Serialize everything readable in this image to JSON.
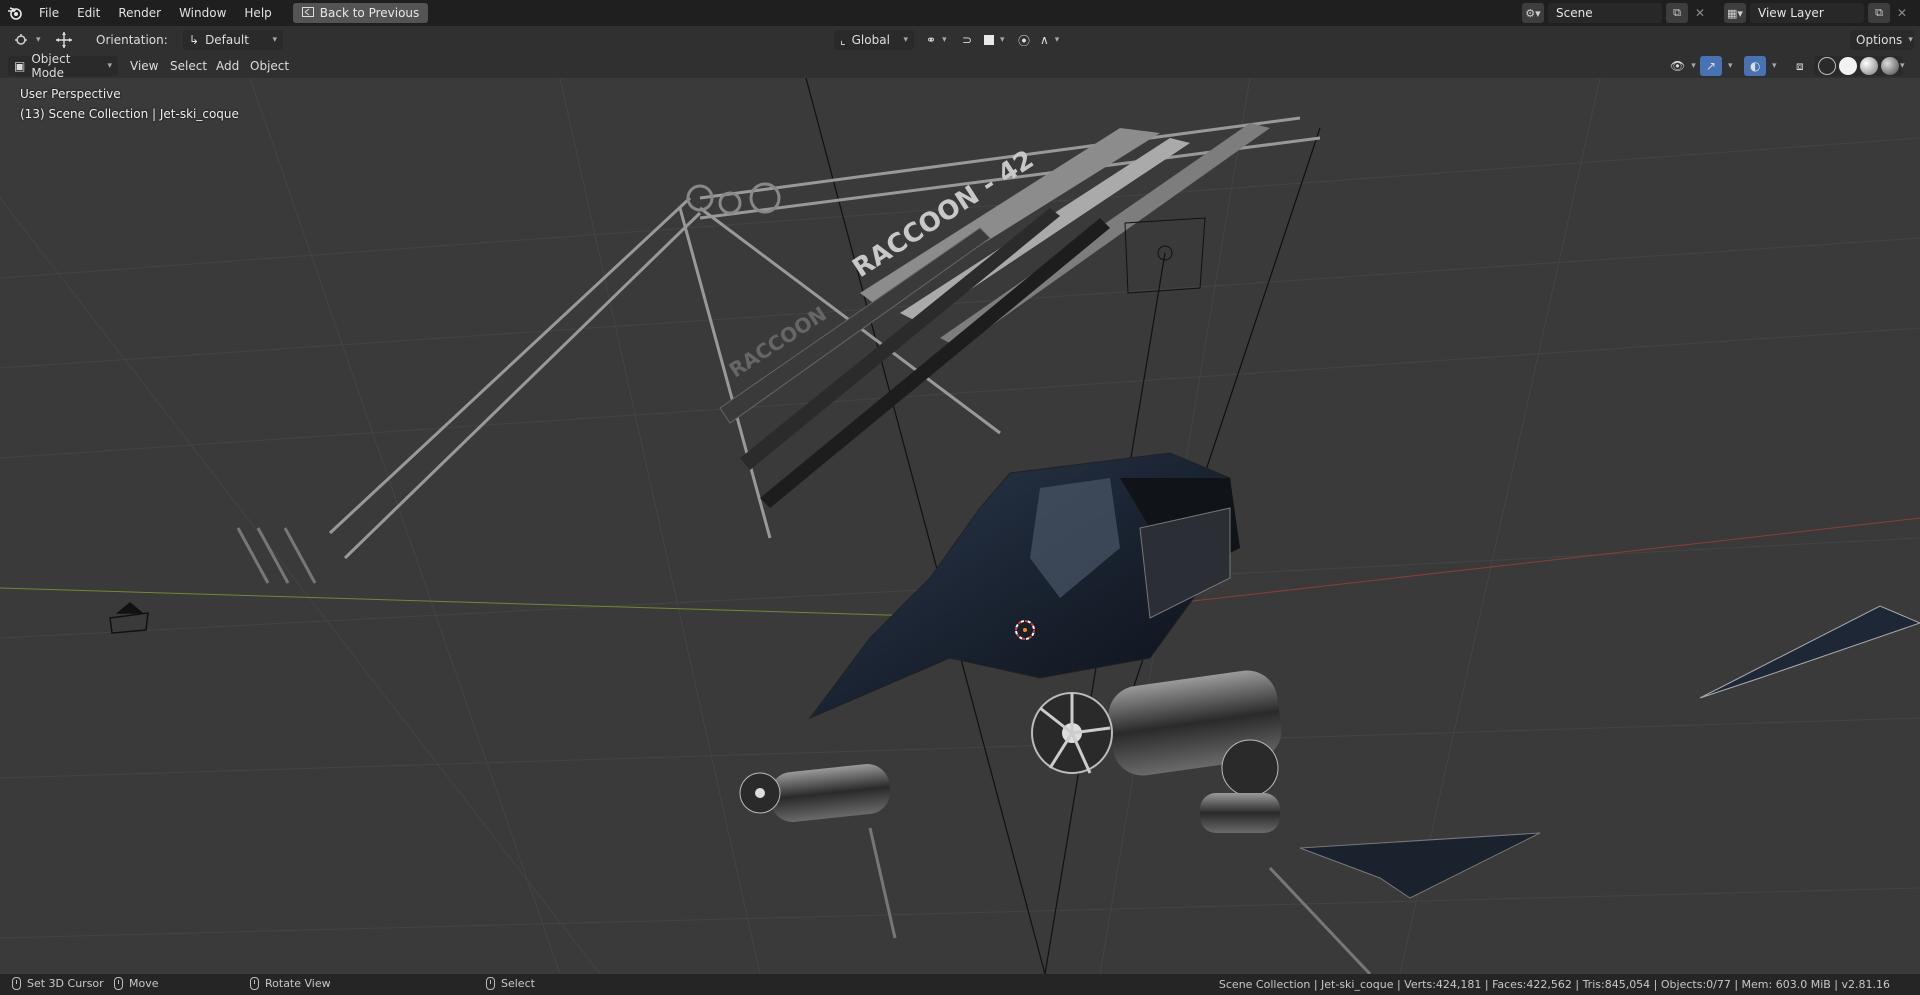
{
  "menu": [
    "File",
    "Edit",
    "Render",
    "Window",
    "Help"
  ],
  "back_button": "Back to Previous",
  "scene": {
    "label": "Scene"
  },
  "view_layer": {
    "label": "View Layer"
  },
  "toolbar": {
    "orientation_label": "Orientation:",
    "orientation_value": "Default",
    "transform_space": "Global",
    "options": "Options"
  },
  "viewport_header": {
    "mode": "Object Mode",
    "menus": [
      "View",
      "Select",
      "Add",
      "Object"
    ]
  },
  "overlay": {
    "perspective": "User Perspective",
    "collection": "(13) Scene Collection | Jet-ski_coque"
  },
  "model_labels": [
    "RACCOON - 42",
    "RACCOON"
  ],
  "status": {
    "hints": [
      "Set 3D Cursor",
      "Move",
      "Rotate View",
      "Select"
    ],
    "info": "Scene Collection | Jet-ski_coque | Verts:424,181 | Faces:422,562 | Tris:845,054 | Objects:0/77 | Mem: 603.0 MiB | v2.81.16"
  },
  "colors": {
    "topbar": "#1f1f1f",
    "header": "#303030",
    "viewport": "#3a3a3a",
    "statusbar": "#252525",
    "x_axis": "#8c3c3c",
    "y_axis": "#6c8a33",
    "accent": "#4772b3"
  },
  "icons": [
    "blender-logo-icon",
    "editor-type-icon",
    "transform-gizmo-icon",
    "orientation-icon",
    "global-axis-icon",
    "pivot-icon",
    "snap-icon",
    "proportional-icon",
    "visibility-icon",
    "gizmo-icon",
    "overlay-icon",
    "xray-icon",
    "wireframe-shading-icon",
    "solid-shading-icon",
    "material-shading-icon",
    "rendered-shading-icon",
    "mouse-icon"
  ]
}
